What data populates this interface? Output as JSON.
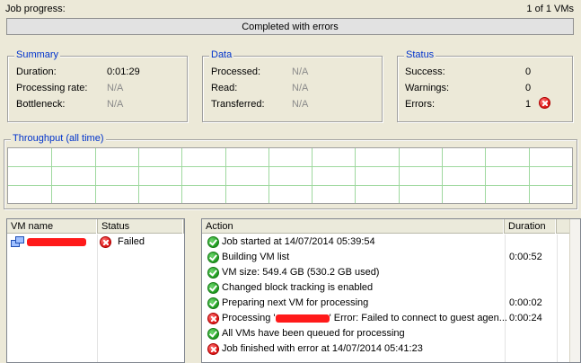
{
  "progress": {
    "label": "Job progress:",
    "vm_count": "1 of 1 VMs",
    "status_text": "Completed with errors",
    "percent": 100
  },
  "summary": {
    "title": "Summary",
    "duration_label": "Duration:",
    "duration_value": "0:01:29",
    "rate_label": "Processing rate:",
    "rate_value": "N/A",
    "bottleneck_label": "Bottleneck:",
    "bottleneck_value": "N/A"
  },
  "data": {
    "title": "Data",
    "processed_label": "Processed:",
    "processed_value": "N/A",
    "read_label": "Read:",
    "read_value": "N/A",
    "transferred_label": "Transferred:",
    "transferred_value": "N/A"
  },
  "status": {
    "title": "Status",
    "success_label": "Success:",
    "success_value": "0",
    "warnings_label": "Warnings:",
    "warnings_value": "0",
    "errors_label": "Errors:",
    "errors_value": "1"
  },
  "throughput": {
    "title": "Throughput (all time)"
  },
  "vm_list": {
    "columns": [
      "VM name",
      "Status"
    ],
    "rows": [
      {
        "name_redacted": true,
        "status": "Failed"
      }
    ]
  },
  "action_list": {
    "columns": [
      "Action",
      "Duration"
    ],
    "rows": [
      {
        "icon": "ok",
        "text": "Job started at 14/07/2014 05:39:54",
        "duration": ""
      },
      {
        "icon": "ok",
        "text": "Building VM list",
        "duration": "0:00:52"
      },
      {
        "icon": "ok",
        "text": "VM size: 549.4 GB (530.2 GB used)",
        "duration": ""
      },
      {
        "icon": "ok",
        "text": "Changed block tracking is enabled",
        "duration": ""
      },
      {
        "icon": "ok",
        "text": "Preparing next VM for processing",
        "duration": "0:00:02"
      },
      {
        "icon": "err",
        "text_prefix": "Processing '",
        "text_suffix": "' Error: Failed to connect to guest agen...",
        "duration": "0:00:24"
      },
      {
        "icon": "ok",
        "text": "All VMs have been queued for processing",
        "duration": ""
      },
      {
        "icon": "err",
        "text": "Job finished with error at 14/07/2014 05:41:23",
        "duration": ""
      }
    ]
  },
  "colors": {
    "background": "#ece9d8",
    "group_title": "#0033cc",
    "chart_grid": "#9ed89e",
    "success": "#1f9b1f",
    "error": "#dd1111",
    "redaction": "#ff1a1a"
  }
}
